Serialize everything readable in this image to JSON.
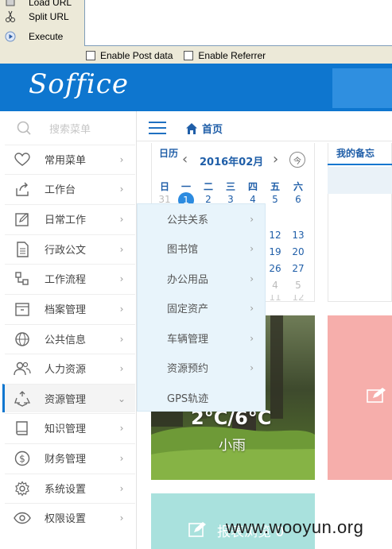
{
  "browser": {
    "menu_items": [
      {
        "label": "Load URL",
        "icon": "load-url-icon"
      },
      {
        "label": "Split URL",
        "icon": "scissors-icon"
      },
      {
        "label": "Execute",
        "icon": "play-icon"
      }
    ],
    "enable_post_label": "Enable Post data",
    "enable_referrer_label": "Enable Referrer"
  },
  "app": {
    "logo": "Soffice",
    "colors": {
      "header": "#0e76cf",
      "accent": "#1f5ea8"
    }
  },
  "sidebar": {
    "search_placeholder": "搜索菜单",
    "items": [
      {
        "label": "常用菜单",
        "icon": "heart-icon"
      },
      {
        "label": "工作台",
        "icon": "share-icon"
      },
      {
        "label": "日常工作",
        "icon": "edit-icon"
      },
      {
        "label": "行政公文",
        "icon": "document-icon"
      },
      {
        "label": "工作流程",
        "icon": "workflow-icon"
      },
      {
        "label": "档案管理",
        "icon": "archive-icon"
      },
      {
        "label": "公共信息",
        "icon": "globe-icon"
      },
      {
        "label": "人力资源",
        "icon": "users-icon"
      },
      {
        "label": "资源管理",
        "icon": "recycle-icon",
        "active": true
      },
      {
        "label": "知识管理",
        "icon": "book-icon"
      },
      {
        "label": "财务管理",
        "icon": "dollar-icon"
      },
      {
        "label": "系统设置",
        "icon": "gear-icon"
      },
      {
        "label": "权限设置",
        "icon": "eye-icon"
      }
    ]
  },
  "submenu": {
    "items": [
      {
        "label": "公共关系",
        "has_children": true
      },
      {
        "label": "图书馆",
        "has_children": true
      },
      {
        "label": "办公用品",
        "has_children": true
      },
      {
        "label": "固定资产",
        "has_children": true
      },
      {
        "label": "车辆管理",
        "has_children": true
      },
      {
        "label": "资源预约",
        "has_children": true
      },
      {
        "label": "GPS轨迹",
        "has_children": false
      }
    ]
  },
  "main": {
    "home_label": "首页",
    "calendar": {
      "tab_label": "日历",
      "month": "2016年02月",
      "today_label": "今",
      "weekdays": [
        "日",
        "一",
        "二",
        "三",
        "四",
        "五",
        "六"
      ],
      "row1": [
        "31",
        "1",
        "2",
        "3",
        "4",
        "5",
        "6"
      ],
      "row2_tail": [
        "12",
        "13"
      ],
      "row3_tail": [
        "19",
        "20"
      ],
      "row4_tail": [
        "26",
        "27"
      ],
      "row5_tail": [
        "4",
        "5"
      ],
      "row6_tail": [
        "11",
        "12"
      ]
    },
    "memo_label": "我的备忘",
    "weather": {
      "temp": "2°C/6°C",
      "condition": "小雨"
    },
    "report_label": "报表浏览 0"
  },
  "watermark": "www.wooyun.org"
}
